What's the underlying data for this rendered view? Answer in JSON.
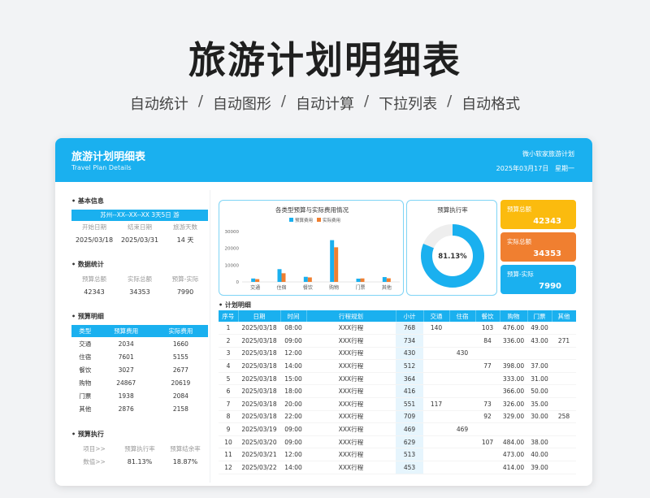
{
  "hero": {
    "title": "旅游计划明细表",
    "features": [
      "自动统计",
      "自动图形",
      "自动计算",
      "下拉列表",
      "自动格式"
    ],
    "separator": "/"
  },
  "header": {
    "title": "旅游计划明细表",
    "subtitle": "Travel Plan Details",
    "org": "微小软家旅游计划",
    "date": "2025年03月17日",
    "weekday": "星期一"
  },
  "basic": {
    "title": "基本信息",
    "route": "苏州--XX--XX--XX 3天5日 游",
    "labels": [
      "开始日期",
      "结束日期",
      "旅游天数"
    ],
    "values": [
      "2025/03/18",
      "2025/03/31",
      "14 天"
    ]
  },
  "stats": {
    "title": "数据统计",
    "labels": [
      "预算总额",
      "实际总额",
      "预算-实际"
    ],
    "values": [
      "42343",
      "34353",
      "7990"
    ]
  },
  "budget": {
    "title": "预算明细",
    "headers": [
      "类型",
      "预算费用",
      "实际费用"
    ],
    "rows": [
      [
        "交通",
        "2034",
        "1660"
      ],
      [
        "住宿",
        "7601",
        "5155"
      ],
      [
        "餐饮",
        "3027",
        "2677"
      ],
      [
        "购物",
        "24867",
        "20619"
      ],
      [
        "门票",
        "1938",
        "2084"
      ],
      [
        "其他",
        "2876",
        "2158"
      ]
    ]
  },
  "execution": {
    "title": "预算执行",
    "labels": [
      "项目>>",
      "预算执行率",
      "预算结余率"
    ],
    "values": [
      "数值>>",
      "81.13%",
      "18.87%"
    ]
  },
  "chart_data": {
    "type": "bar",
    "title": "各类型预算与实际费用情况",
    "categories": [
      "交通",
      "住宿",
      "餐饮",
      "购物",
      "门票",
      "其他"
    ],
    "series": [
      {
        "name": "预算费用",
        "values": [
          2034,
          7601,
          3027,
          24867,
          1938,
          2876
        ]
      },
      {
        "name": "实际费用",
        "values": [
          1660,
          5155,
          2677,
          20619,
          2084,
          2158
        ]
      }
    ],
    "yticks": [
      "0",
      "10000",
      "20000",
      "30000"
    ],
    "ylim": [
      0,
      30000
    ],
    "legend": "top",
    "grid": false,
    "colors": {
      "budget": "#1ab0ef",
      "actual": "#f07f30"
    }
  },
  "donut": {
    "title": "预算执行率",
    "label": "81.13%",
    "value": 0.8113,
    "color": "#1ab0ef",
    "track": "#eeeeee"
  },
  "kpis": [
    {
      "label": "预算总额",
      "value": "42343",
      "color": "#fbbb0e"
    },
    {
      "label": "实际总额",
      "value": "34353",
      "color": "#f07f30"
    },
    {
      "label": "预算-实际",
      "value": "7990",
      "color": "#1ab0ef"
    }
  ],
  "plan": {
    "title": "计划明细",
    "headers": [
      "序号",
      "日期",
      "时间",
      "行程规划",
      "小计",
      "交通",
      "住宿",
      "餐饮",
      "购物",
      "门票",
      "其他"
    ],
    "rows": [
      [
        "1",
        "2025/03/18",
        "08:00",
        "XXX行程",
        "768",
        "140",
        "",
        "103",
        "476.00",
        "49.00",
        ""
      ],
      [
        "2",
        "2025/03/18",
        "09:00",
        "XXX行程",
        "734",
        "",
        "",
        "84",
        "336.00",
        "43.00",
        "271"
      ],
      [
        "3",
        "2025/03/18",
        "12:00",
        "XXX行程",
        "430",
        "",
        "430",
        "",
        "",
        "",
        ""
      ],
      [
        "4",
        "2025/03/18",
        "14:00",
        "XXX行程",
        "512",
        "",
        "",
        "77",
        "398.00",
        "37.00",
        ""
      ],
      [
        "5",
        "2025/03/18",
        "15:00",
        "XXX行程",
        "364",
        "",
        "",
        "",
        "333.00",
        "31.00",
        ""
      ],
      [
        "6",
        "2025/03/18",
        "18:00",
        "XXX行程",
        "416",
        "",
        "",
        "",
        "366.00",
        "50.00",
        ""
      ],
      [
        "7",
        "2025/03/18",
        "20:00",
        "XXX行程",
        "551",
        "117",
        "",
        "73",
        "326.00",
        "35.00",
        ""
      ],
      [
        "8",
        "2025/03/18",
        "22:00",
        "XXX行程",
        "709",
        "",
        "",
        "92",
        "329.00",
        "30.00",
        "258"
      ],
      [
        "9",
        "2025/03/19",
        "09:00",
        "XXX行程",
        "469",
        "",
        "469",
        "",
        "",
        "",
        ""
      ],
      [
        "10",
        "2025/03/20",
        "09:00",
        "XXX行程",
        "629",
        "",
        "",
        "107",
        "484.00",
        "38.00",
        ""
      ],
      [
        "11",
        "2025/03/21",
        "12:00",
        "XXX行程",
        "513",
        "",
        "",
        "",
        "473.00",
        "40.00",
        ""
      ],
      [
        "12",
        "2025/03/22",
        "14:00",
        "XXX行程",
        "453",
        "",
        "",
        "",
        "414.00",
        "39.00",
        ""
      ]
    ]
  }
}
